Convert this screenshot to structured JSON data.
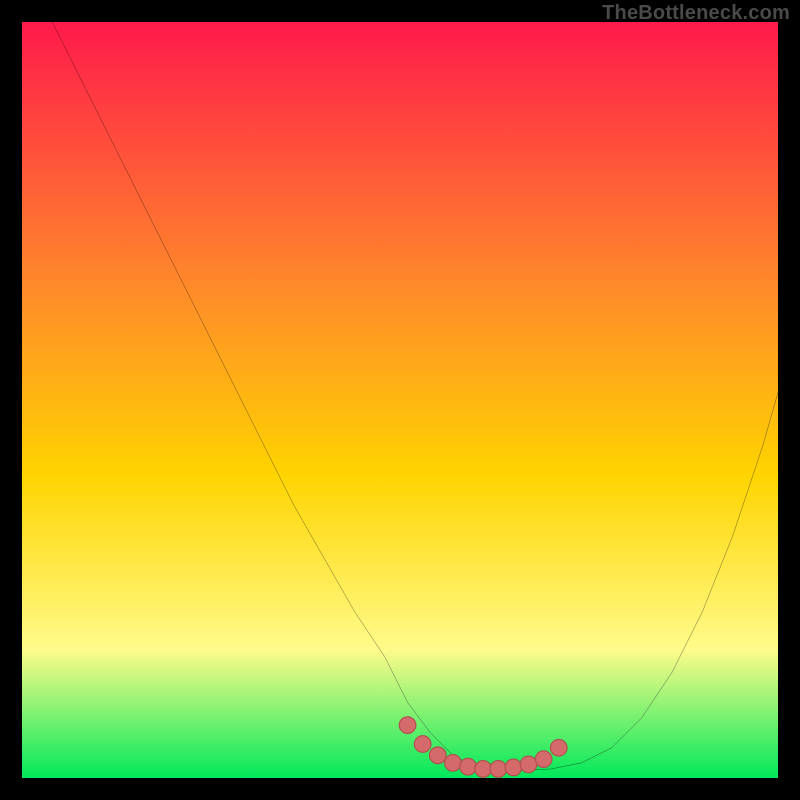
{
  "watermark": "TheBottleneck.com",
  "colors": {
    "gradient_top": "#ff1a4b",
    "gradient_mid1": "#ff8a2a",
    "gradient_mid2": "#ffd400",
    "gradient_mid3": "#fffb8a",
    "gradient_bottom": "#00e85a",
    "curve": "#000000",
    "marker_fill": "#d46a6a",
    "marker_stroke": "#b24e4e"
  },
  "chart_data": {
    "type": "line",
    "title": "",
    "xlabel": "",
    "ylabel": "",
    "xlim": [
      0,
      100
    ],
    "ylim": [
      0,
      100
    ],
    "series": [
      {
        "name": "bottleneck-curve",
        "x": [
          4,
          8,
          12,
          16,
          20,
          24,
          28,
          32,
          36,
          40,
          44,
          48,
          51,
          54,
          57,
          60,
          63,
          66,
          70,
          74,
          78,
          82,
          86,
          90,
          94,
          98,
          100
        ],
        "y": [
          100,
          92,
          84,
          76,
          68,
          60,
          52,
          44,
          36,
          29,
          22,
          16,
          10,
          6,
          3,
          1.5,
          1,
          1,
          1.2,
          2,
          4,
          8,
          14,
          22,
          32,
          44,
          51
        ]
      }
    ],
    "markers": {
      "name": "trough-markers",
      "x": [
        51,
        53,
        55,
        57,
        59,
        61,
        63,
        65,
        67,
        69,
        71
      ],
      "y": [
        7,
        4.5,
        3,
        2,
        1.5,
        1.2,
        1.2,
        1.4,
        1.8,
        2.5,
        4
      ]
    }
  }
}
